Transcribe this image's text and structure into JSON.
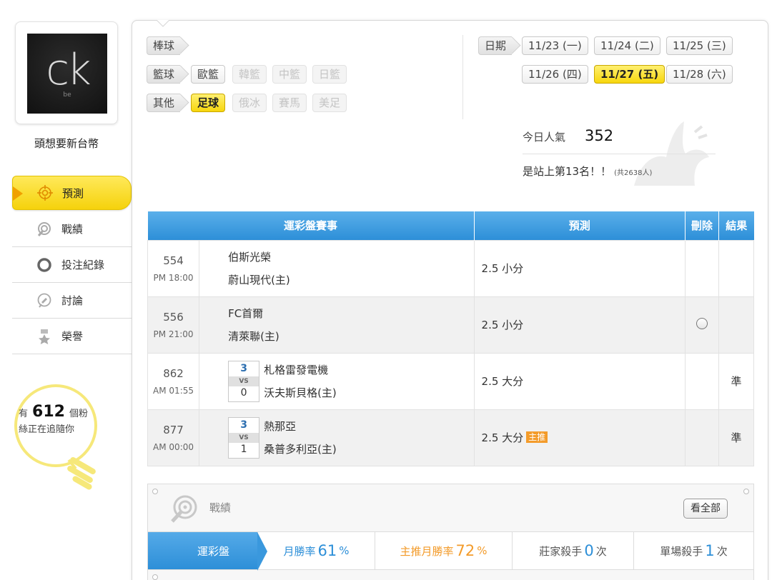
{
  "profile": {
    "avatar_text": "ck",
    "avatar_sub": "be",
    "username": "頭想要新台幣"
  },
  "sidebar": {
    "items": [
      {
        "label": "預測",
        "icon": "target-icon",
        "active": true
      },
      {
        "label": "戰績",
        "icon": "record-icon",
        "active": false
      },
      {
        "label": "投注紀錄",
        "icon": "circle-icon",
        "active": false
      },
      {
        "label": "討論",
        "icon": "chat-icon",
        "active": false
      },
      {
        "label": "榮譽",
        "icon": "medal-icon",
        "active": false
      }
    ]
  },
  "fans": {
    "prefix": "有",
    "count": "612",
    "suffix": "個粉",
    "line2": "絲正在追隨你"
  },
  "categories": {
    "baseball_label": "棒球",
    "basketball_label": "籃球",
    "basketball_items": [
      "歐籃",
      "韓籃",
      "中籃",
      "日籃"
    ],
    "other_label": "其他",
    "other_items": [
      "足球",
      "俄冰",
      "賽馬",
      "美足"
    ]
  },
  "dates": {
    "label": "日期",
    "items": [
      "11/23 (一)",
      "11/24 (二)",
      "11/25 (三)",
      "11/26 (四)",
      "11/27 (五)",
      "11/28 (六)"
    ],
    "selected": "11/27 (五)"
  },
  "popularity": {
    "label": "今日人氣",
    "count": "352",
    "rank_text": "是站上第13名！！",
    "rank_sub": "(共2638人)"
  },
  "table": {
    "headers": [
      "運彩盤賽事",
      "預測",
      "刪除",
      "結果"
    ],
    "rows": [
      {
        "num": "554",
        "time": "PM 18:00",
        "team1": "伯斯光榮",
        "team2": "蔚山現代(主)",
        "score1": "",
        "score2": "",
        "vs": "",
        "prediction": "2.5 小分",
        "hot": "",
        "deletable": false,
        "result": ""
      },
      {
        "num": "556",
        "time": "PM 21:00",
        "team1": "FC首爾",
        "team2": "清萊聯(主)",
        "score1": "",
        "score2": "",
        "vs": "",
        "prediction": "2.5 小分",
        "hot": "",
        "deletable": true,
        "result": ""
      },
      {
        "num": "862",
        "time": "AM 01:55",
        "team1": "札格雷發電機",
        "team2": "沃夫斯貝格(主)",
        "score1": "3",
        "score2": "0",
        "vs": "VS",
        "prediction": "2.5 大分",
        "hot": "",
        "deletable": false,
        "result": "準"
      },
      {
        "num": "877",
        "time": "AM 00:00",
        "team1": "熱那亞",
        "team2": "桑普多利亞(主)",
        "score1": "3",
        "score2": "1",
        "vs": "VS",
        "prediction": "2.5 大分",
        "hot": "主推",
        "deletable": false,
        "result": "準"
      }
    ]
  },
  "record": {
    "title": "戰績",
    "view_all": "看全部",
    "stats": [
      {
        "label": "運彩盤",
        "value": "",
        "unit": ""
      },
      {
        "label": "月勝率",
        "value": "61",
        "unit": "%"
      },
      {
        "label": "主推月勝率",
        "value": "72",
        "unit": "%"
      },
      {
        "label": "莊家殺手",
        "value": "0",
        "unit": "次"
      },
      {
        "label": "單場殺手",
        "value": "1",
        "unit": "次"
      }
    ]
  },
  "colors": {
    "accent_blue": "#2d8fd8",
    "accent_yellow": "#f7d60d",
    "orange": "#f39b2a",
    "green": "#2a9d3a"
  }
}
